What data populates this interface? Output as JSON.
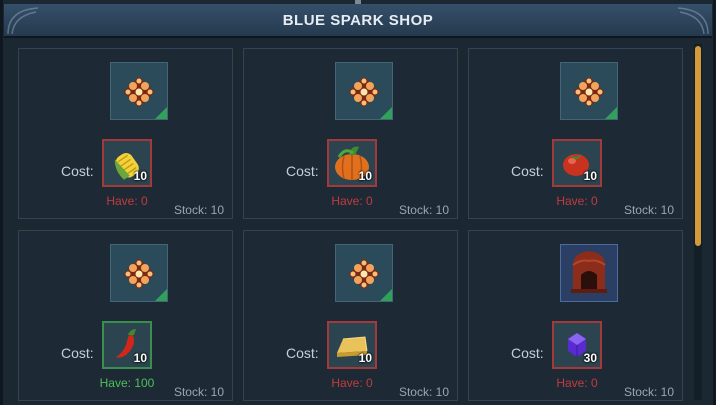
{
  "shop": {
    "title": "BLUE SPARK SHOP"
  },
  "cost_label": "Cost:",
  "cards": [
    {
      "reward": "blue-spark-icon",
      "cost_item": "corn-icon",
      "cost_qty": "10",
      "have": "Have: 0",
      "have_ok": false,
      "stock": "Stock: 10"
    },
    {
      "reward": "blue-spark-icon",
      "cost_item": "pumpkin-icon",
      "cost_qty": "10",
      "have": "Have: 0",
      "have_ok": false,
      "stock": "Stock: 10"
    },
    {
      "reward": "blue-spark-icon",
      "cost_item": "tomato-icon",
      "cost_qty": "10",
      "have": "Have: 0",
      "have_ok": false,
      "stock": "Stock: 10"
    },
    {
      "reward": "blue-spark-icon",
      "cost_item": "chili-pepper-icon",
      "cost_qty": "10",
      "have": "Have: 100",
      "have_ok": true,
      "stock": "Stock: 10"
    },
    {
      "reward": "blue-spark-icon",
      "cost_item": "cheese-icon",
      "cost_qty": "10",
      "have": "Have: 0",
      "have_ok": false,
      "stock": "Stock: 10"
    },
    {
      "reward": "furnace-icon",
      "cost_item": "purple-gem-icon",
      "cost_qty": "30",
      "have": "Have: 0",
      "have_ok": false,
      "stock": "Stock: 10"
    }
  ],
  "colors": {
    "have_short": "#c23b3b",
    "have_ok": "#4fbf5b",
    "scroll_thumb": "#d49a3c"
  }
}
